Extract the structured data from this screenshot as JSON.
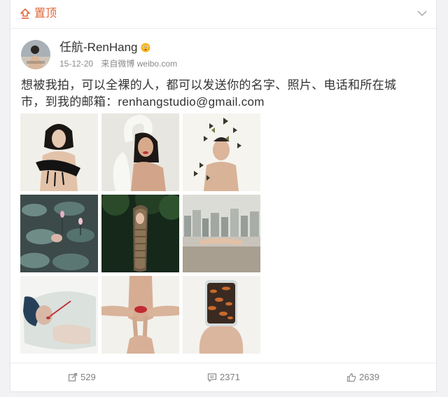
{
  "pin_bar": {
    "label": "置顶",
    "accent_color": "#e0683a",
    "pin_icon": "pin-icon",
    "collapse_icon": "chevron-down-icon"
  },
  "author": {
    "name": "任航-RenHang",
    "badge_icon": "emoji-face-icon",
    "date": "15-12-20",
    "source": "来自微博 weibo.com"
  },
  "post": {
    "text": "想被我拍，可以全裸的人，都可以发送你的名字、照片、电话和所在城市，到我的邮箱：renhangstudio@gmail.com"
  },
  "photos": [
    {
      "name": "photo-woman-black-swan"
    },
    {
      "name": "photo-woman-white-swan"
    },
    {
      "name": "photo-man-butterflies"
    },
    {
      "name": "photo-lily-pads"
    },
    {
      "name": "photo-boat-trees"
    },
    {
      "name": "photo-rooftop-city"
    },
    {
      "name": "photo-bath-woman"
    },
    {
      "name": "photo-hands-face"
    },
    {
      "name": "photo-fish-jar"
    }
  ],
  "actions": {
    "repost_count": "529",
    "comment_count": "2371",
    "like_count": "2639",
    "repost_icon": "repost-icon",
    "comment_icon": "comment-icon",
    "like_icon": "thumbs-up-icon"
  }
}
